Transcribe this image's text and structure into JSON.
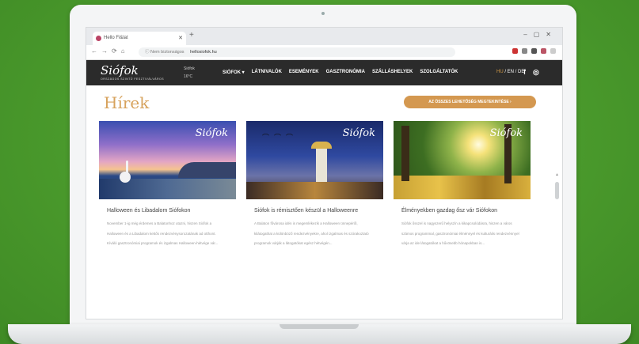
{
  "browser": {
    "tab_title": "Hello Fi&lat",
    "address_security": "Nem biztonságos",
    "address_url": "hellosiofok.hu"
  },
  "site": {
    "logo": "Siófok",
    "logo_sub": "ORSZÁGOS SZINTŰ FESZTIVÁLVÁROS",
    "weather_label": "Siófok",
    "weather_value": "16°C",
    "menu": [
      "SIÓFOK ▾",
      "LÁTNIVALÓK",
      "ESEMÉNYEK",
      "GASZTRONÓMIA",
      "SZÁLLÁSHELYEK",
      "SZOLGÁLTATÓK"
    ],
    "lang_hu": "HU",
    "lang_rest": " / EN / DE",
    "social": [
      "f",
      "◎"
    ]
  },
  "news": {
    "heading": "Hírek",
    "all_button": "AZ ÖSSZES LEHETŐSÉG MEGTEKINTÉSE ›",
    "cards": [
      {
        "title": "Halloween és Libadalom Siófokon",
        "text": "November 1-ig még érdemes a Balatonhoz utazni, hiszen Siófok a Halloween és a Libadalom kettős rendezvénysorozatának ad otthont. Kíváló gasztronómiai programok és izgalmas Halloween-hétvége vár..."
      },
      {
        "title": "Siófok is rémisztően készül a Halloweenre",
        "text": "A Balaton fővárosa idén is megemlékezik a Halloween ünnepéről, kilátogathat a különböző rendezvényekre, ahol izgalmas és szórakoztató programok várják a látogatókat egész hétvégén..."
      },
      {
        "title": "Élményekben gazdag ősz vár Siófokon",
        "text": "Siófok ősszel is nagyszerű helyszín a kikapcsolódásra, hiszen a város számos programmal, gasztronómiai élménnyel és kulturális rendezvénnyel várja az ide látogatókat a hűvösebb hónapokban is..."
      }
    ]
  },
  "colors": {
    "accent": "#d49850",
    "nav_bg": "#2b2b2b",
    "background": "#4a9a2c"
  }
}
